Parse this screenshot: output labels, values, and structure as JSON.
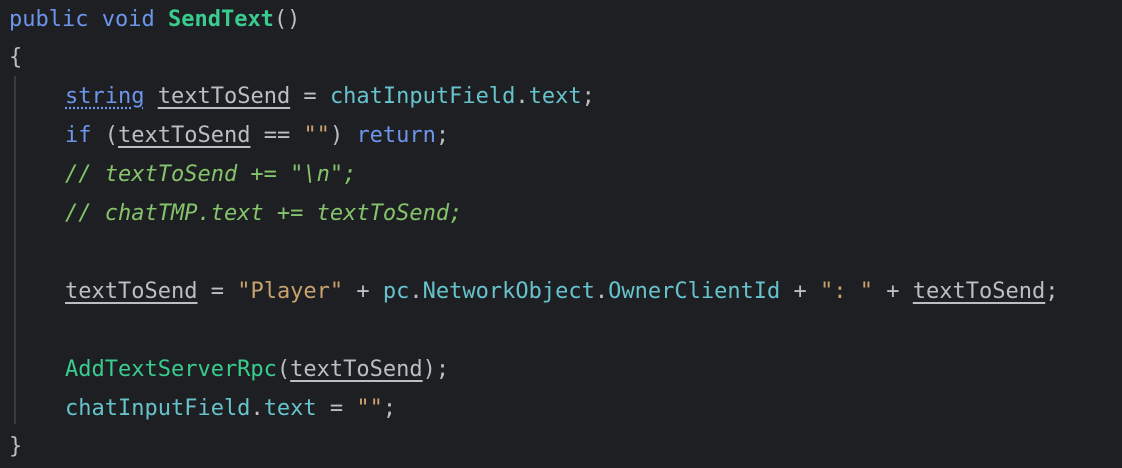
{
  "code": {
    "l1": {
      "kw_public": "public",
      "kw_void": "void",
      "method": "SendText",
      "parens": "()"
    },
    "l2": {
      "brace": "{"
    },
    "l3": {
      "type": "string",
      "var": "textToSend",
      "eq": " = ",
      "obj": "chatInputField",
      "dot": ".",
      "prop": "text",
      "semi": ";"
    },
    "l4": {
      "kw_if": "if",
      "open": " (",
      "var": "textToSend",
      "op": " == ",
      "str": "\"\"",
      "close": ") ",
      "kw_return": "return",
      "semi": ";"
    },
    "l5": {
      "comment": "// textToSend += \"\\n\";"
    },
    "l6": {
      "comment": "// chatTMP.text += textToSend;"
    },
    "l7": {
      "var": "textToSend",
      "eq": " = ",
      "str1": "\"Player\"",
      "plus1": " + ",
      "pc": "pc",
      "dot1": ".",
      "netobj": "NetworkObject",
      "dot2": ".",
      "owner": "OwnerClientId",
      "plus2": " + ",
      "str2": "\": \"",
      "plus3": " + ",
      "var2": "textToSend",
      "semi": ";"
    },
    "l8": {
      "method": "AddTextServerRpc",
      "open": "(",
      "var": "textToSend",
      "close": ");"
    },
    "l9": {
      "obj": "chatInputField",
      "dot": ".",
      "prop": "text",
      "eq": " = ",
      "str": "\"\"",
      "semi": ";"
    },
    "l10": {
      "brace": "}"
    }
  },
  "colors": {
    "background": "#1e1f22",
    "keyword": "#6c95eb",
    "method": "#39cc8f",
    "reference": "#66c3cc",
    "string": "#c9a26d",
    "comment": "#85c46c",
    "text": "#bcbec4"
  }
}
